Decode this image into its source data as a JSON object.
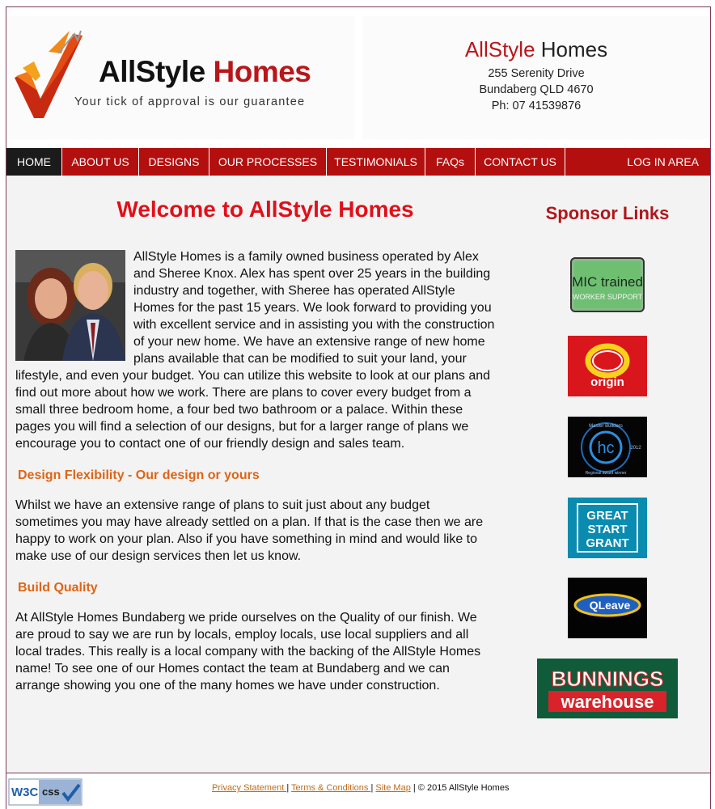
{
  "header": {
    "logo_brand_a": "AllStyle",
    "logo_brand_b": "Homes",
    "logo_tagline": "Your tick of approval is our guarantee",
    "contact_brand_a": "AllStyle",
    "contact_brand_b": "Homes",
    "address_street": "255 Serenity Drive",
    "address_city": "Bundaberg QLD 4670",
    "phone": "Ph: 07 41539876"
  },
  "nav": {
    "items": [
      {
        "label": "HOME",
        "active": true
      },
      {
        "label": "ABOUT US"
      },
      {
        "label": "DESIGNS"
      },
      {
        "label": "OUR PROCESSES"
      },
      {
        "label": "TESTIMONIALS"
      },
      {
        "label": "FAQs"
      },
      {
        "label": "CONTACT US"
      }
    ],
    "login": "LOG IN AREA"
  },
  "main": {
    "title": "Welcome to AllStyle Homes",
    "intro": "AllStyle Homes is a family owned business operated by Alex and Sheree Knox. Alex has spent over 25 years in the building industry and together, with Sheree has operated AllStyle Homes for the past 15 years. We look forward to providing you with excellent service and in assisting you with the construction of your new home. We have an extensive range of new home plans available that can be modified to suit your land, your lifestyle, and even your budget. You can utilize this website to look at our plans and find out more about how we work. There are plans to cover every budget from a small three bedroom home, a four bed two bathroom or a palace. Within these pages you will find a selection of our designs, but for a larger range of plans we encourage you to contact one of our friendly design and sales team.",
    "section1_heading": "Design Flexibility - Our design or yours",
    "section1_text": "Whilst we have an extensive range of plans to suit just about any budget sometimes you may have already settled on a plan. If that is the case then we are happy to work on your plan. Also if you have something in mind and would like to make use of our design services then let us know.",
    "section2_heading": "Build Quality",
    "section2_text": "At AllStyle Homes Bundaberg we pride ourselves on the Quality of our finish. We are proud to say we are run by locals, employ locals, use local suppliers and all local trades. This really is a local company with the backing of the AllStyle Homes name! To see one of our Homes contact the team at Bundaberg and we can arrange showing you one of the many homes we have under construction."
  },
  "sponsors": {
    "title": "Sponsor Links",
    "mic_line1": "MIC trained",
    "mic_line2": "WORKER SUPPORT",
    "origin": "origin",
    "mb_ring": "Master Builders",
    "mb_mark": "hc",
    "mb_sub": "Regional award winner",
    "mb_year": "2012",
    "gsg_1": "GREAT",
    "gsg_2": "START",
    "gsg_3": "GRANT",
    "qleave": "QLeave",
    "bunnings_1": "BUNNINGS",
    "bunnings_2": "warehouse"
  },
  "footer": {
    "badge_a": "W3C",
    "badge_b": "css",
    "privacy": "Privacy Statement ",
    "terms": "Terms & Conditions ",
    "sitemap": "Site Map",
    "copyright": " | © 2015 AllStyle Homes"
  },
  "colors": {
    "nav_red": "#b30f0f",
    "nav_active": "#1b1b1b",
    "title_red": "#e0101a",
    "heading_orange": "#dd6516",
    "sponsor_title": "#b0161a"
  }
}
